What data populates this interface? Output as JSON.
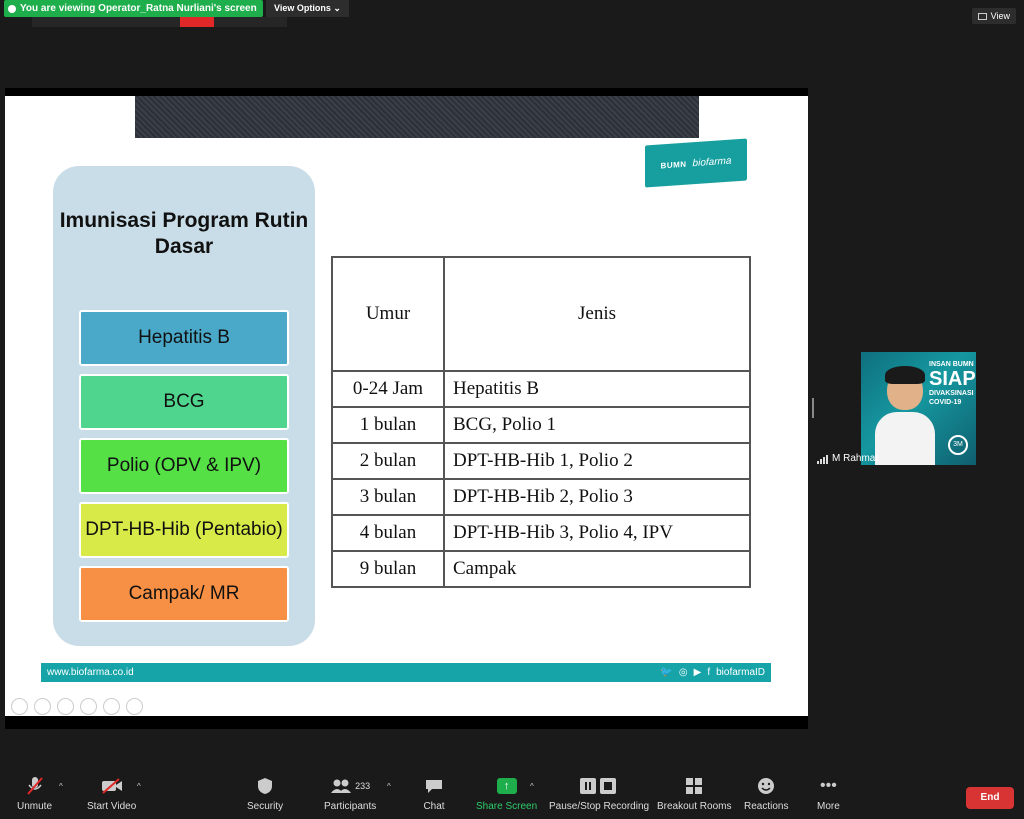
{
  "top_bar": {
    "share_banner": "You are viewing Operator_Ratna Nurliani's screen",
    "view_options": "View Options",
    "view_button": "View"
  },
  "slide": {
    "logo_bumn": "BUMN",
    "logo_biofarma": "biofarma",
    "panel_title": "Imunisasi Program Rutin Dasar",
    "vaccines": [
      {
        "label": "Hepatitis B",
        "color": "#4aa9c9"
      },
      {
        "label": "BCG",
        "color": "#4fd58e"
      },
      {
        "label": "Polio (OPV & IPV)",
        "color": "#55e046"
      },
      {
        "label": "DPT-HB-Hib (Pentabio)",
        "color": "#d7ea47"
      },
      {
        "label": "Campak/ MR",
        "color": "#f79044"
      }
    ],
    "table": {
      "headers": [
        "Umur",
        "Jenis"
      ],
      "rows": [
        [
          "0-24 Jam",
          "Hepatitis B"
        ],
        [
          "1 bulan",
          "BCG, Polio 1"
        ],
        [
          "2 bulan",
          "DPT-HB-Hib 1, Polio 2"
        ],
        [
          "3 bulan",
          "DPT-HB-Hib 2, Polio 3"
        ],
        [
          "4 bulan",
          "DPT-HB-Hib 3, Polio 4, IPV"
        ],
        [
          "9 bulan",
          "Campak"
        ]
      ]
    },
    "footer_url": "www.biofarma.co.id",
    "footer_handle": "biofarmaID"
  },
  "participant": {
    "name": "M Rahmat",
    "thumb_text_1": "INSAN BUMN",
    "thumb_text_2": "SIAP",
    "thumb_text_3": "DIVAKSINASI COVID-19",
    "thumb_badge": "3M"
  },
  "toolbar": {
    "unmute": "Unmute",
    "start_video": "Start Video",
    "security": "Security",
    "participants": "Participants",
    "participants_count": "233",
    "chat": "Chat",
    "share_screen": "Share Screen",
    "pause_stop": "Pause/Stop Recording",
    "breakout": "Breakout Rooms",
    "reactions": "Reactions",
    "more": "More",
    "end": "End"
  },
  "colors": {
    "accent_teal": "#17a4a9",
    "share_green": "#1fae4c",
    "end_red": "#d83434"
  }
}
